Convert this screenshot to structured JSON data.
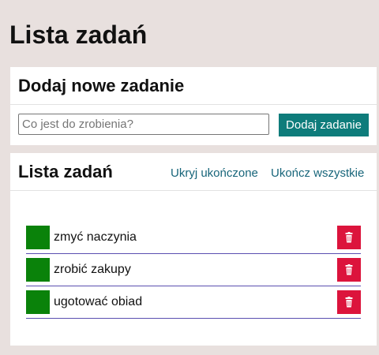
{
  "page": {
    "title": "Lista zadań"
  },
  "add_card": {
    "title": "Dodaj nowe zadanie",
    "input_placeholder": "Co jest do zrobienia?",
    "input_value": "",
    "button_label": "Dodaj zadanie"
  },
  "list_card": {
    "title": "Lista zadań",
    "hide_completed_label": "Ukryj ukończone",
    "complete_all_label": "Ukończ wszystkie",
    "tasks": [
      {
        "text": "zmyć naczynia",
        "status_icon": "green-square",
        "delete_icon": "trash-icon"
      },
      {
        "text": "zrobić zakupy",
        "status_icon": "green-square",
        "delete_icon": "trash-icon"
      },
      {
        "text": "ugotować obiad",
        "status_icon": "green-square",
        "delete_icon": "trash-icon"
      }
    ]
  },
  "colors": {
    "background": "#e8e0de",
    "accent": "#0e7c7b",
    "link": "#17657a",
    "task_check": "#0a820a",
    "delete": "#dc143c",
    "row_divider": "#5a4fb0"
  }
}
